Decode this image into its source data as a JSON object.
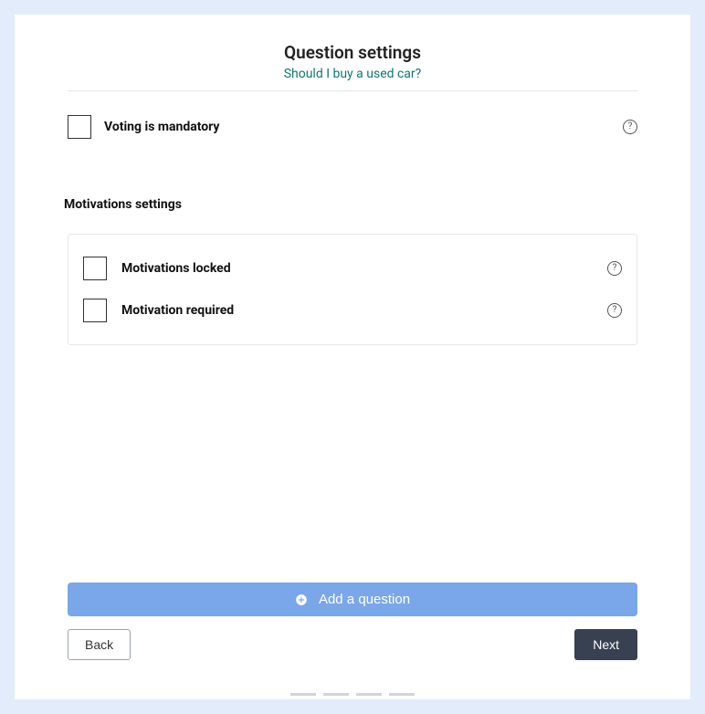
{
  "header": {
    "title": "Question settings",
    "subtitle": "Should I buy a used car?"
  },
  "settings": {
    "voting_mandatory_label": "Voting is mandatory"
  },
  "motivations": {
    "section_title": "Motivations settings",
    "locked_label": "Motivations locked",
    "required_label": "Motivation required"
  },
  "actions": {
    "add_question": "Add a question",
    "back": "Back",
    "next": "Next"
  },
  "icons": {
    "help": "?"
  },
  "progress": {
    "steps": 4
  }
}
